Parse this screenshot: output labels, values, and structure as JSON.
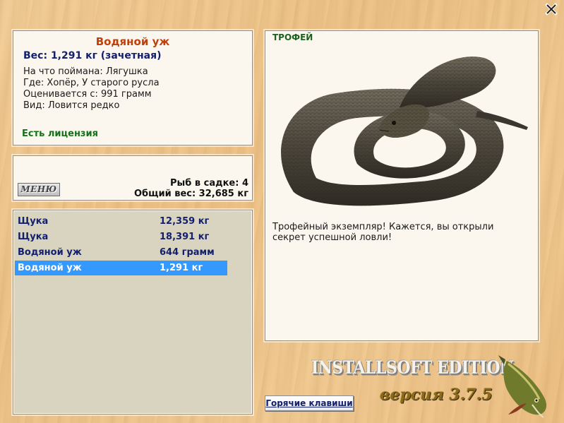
{
  "window": {
    "close_icon": "close-icon"
  },
  "info": {
    "title": "Водяной уж",
    "weight_line": "Вес: 1,291 кг (зачетная)",
    "lines": [
      "На что поймана: Лягушка",
      "Где: Хопёр, У старого русла",
      "Оценивается с: 991 грамм",
      "Вид: Ловится редко"
    ],
    "license": "Есть лицензия"
  },
  "menu": {
    "button_label": "МЕНЮ",
    "cage_count": "Рыб в садке: 4",
    "total_weight": "Общий вес: 32,685 кг"
  },
  "catch_list": [
    {
      "name": "Щука",
      "weight": "12,359 кг",
      "selected": false
    },
    {
      "name": "Щука",
      "weight": "18,391 кг",
      "selected": false
    },
    {
      "name": "Водяной уж",
      "weight": "644 грамм",
      "selected": false
    },
    {
      "name": "Водяной уж",
      "weight": "1,291 кг",
      "selected": true
    }
  ],
  "trophy": {
    "label": "ТРОФЕЙ",
    "image": "water-snake-image",
    "text": "Трофейный экземпляр! Кажется, вы открыли секрет успешной ловли!"
  },
  "branding": {
    "edition": "INSTALLSOFT EDITION",
    "version": "версия 3.7.5",
    "logo": "pike-logo"
  },
  "footer": {
    "hotkeys_label": "Горячие клавиши"
  },
  "colors": {
    "title": "#c0400b",
    "accent_text": "#14206e",
    "license": "#15701c",
    "selection": "#3399ff"
  }
}
